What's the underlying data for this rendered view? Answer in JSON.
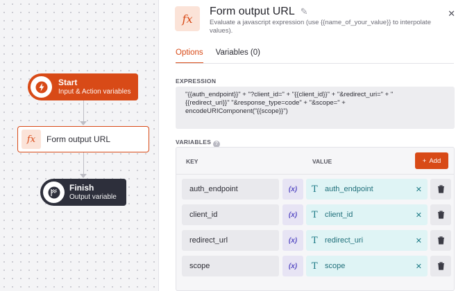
{
  "canvas": {
    "start": {
      "title": "Start",
      "subtitle": "Input & Action variables"
    },
    "form": {
      "icon": "fx",
      "label": "Form output URL"
    },
    "finish": {
      "title": "Finish",
      "subtitle": "Output variable"
    }
  },
  "panel": {
    "icon": "fx",
    "title": "Form output URL",
    "description": "Evaluate a javascript expression (use {{name_of_your_value}} to interpolate values).",
    "tabs": [
      {
        "label": "Options",
        "active": true
      },
      {
        "label": "Variables (0)",
        "active": false
      }
    ],
    "expression_label": "EXPRESSION",
    "expression": "\"{{auth_endpoint}}\" + \"?client_id=\" + \"{{client_id}}\" + \"&redirect_uri=\" + \"\n{{redirect_uri}}\" \"&response_type=code\" + \"&scope=\" +\nencodeURIComponent(\"{{scope}}\")",
    "variables_label": "VARIABLES",
    "key_header": "KEY",
    "value_header": "VALUE",
    "add_label": "Add",
    "variables": [
      {
        "key": "auth_endpoint",
        "value": "auth_endpoint"
      },
      {
        "key": "client_id",
        "value": "client_id"
      },
      {
        "key": "redirect_url",
        "value": "redirect_uri"
      },
      {
        "key": "scope",
        "value": "scope"
      }
    ]
  },
  "colors": {
    "accent": "#d84a17",
    "finish": "#2d2f3b",
    "value_bg": "#dff4f5",
    "var_btn": "#e7e4f4"
  }
}
